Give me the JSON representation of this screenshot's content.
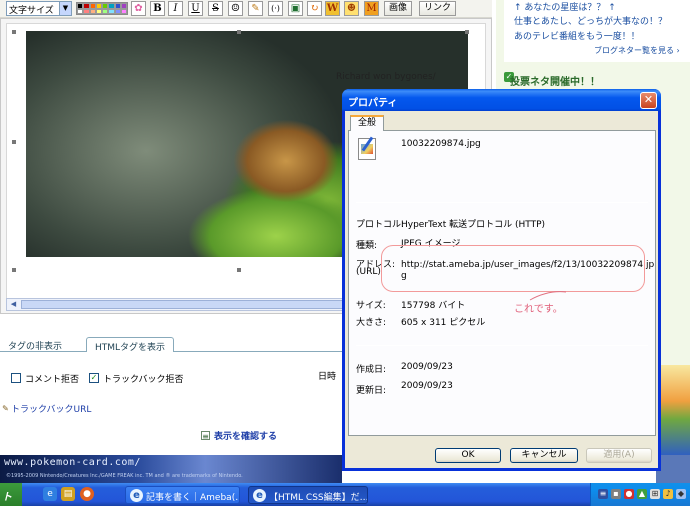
{
  "toolbar": {
    "font_size_label": "文字サイズ",
    "bold": "B",
    "italic": "I",
    "underline": "U",
    "strike": "S",
    "image_btn": "画像",
    "link_btn": "リンク",
    "palette_colors": [
      "#000000",
      "#c00000",
      "#ff6600",
      "#ffcc00",
      "#66cc00",
      "#00a0c0",
      "#3050d0",
      "#a040c0",
      "#ffffff",
      "#ff8080",
      "#ffb080",
      "#ffff80",
      "#a0ff80",
      "#80e0ff",
      "#8090ff",
      "#ff80ff"
    ]
  },
  "editor": {
    "photo_caption": "Richard won bygones/",
    "tabs": [
      "タグの非表示",
      "HTMLタグを表示"
    ],
    "comment_option": "コメント拒否",
    "trackback_option": "トラックバック拒否",
    "trackback_url": "トラックバックURL",
    "confirm_link": "表示を確認する",
    "date_label": "日時"
  },
  "sidebar": {
    "items": [
      "↑ あなたの星座は？？ ↑",
      "仕事とあたし、どっちが大事なの！？",
      "あのテレビ番組をもう一度！！"
    ],
    "more_link": "ブログネター覧を見る",
    "heading": "投票ネタ開催中！！"
  },
  "banner": {
    "text": "www.pokemon-card.com/",
    "small": "©1995-2009 Nintendo/Creatures Inc./GAME FREAK inc. TM and ® are trademarks of Nintendo."
  },
  "taskbar": {
    "start": "ト",
    "tasks": [
      "記事を書く｜Ameba(…",
      "【HTML CSS編集】だ…"
    ]
  },
  "dialog": {
    "title": "プロパティ",
    "tab": "全般",
    "filename": "10032209874.jpg",
    "protocol_label": "プロトコル:",
    "protocol_value": "HyperText 転送プロトコル (HTTP)",
    "type_label": "種類:",
    "type_value": "JPEG イメージ",
    "address_label_1": "アドレス:",
    "address_label_2": "(URL)",
    "address_value_1": "http://stat.ameba.jp/user_images/f2/13/10032209874.jp",
    "address_value_2": "g",
    "size_label": "サイズ:",
    "size_value": "157798 バイト",
    "dimensions_label": "大きさ:",
    "dimensions_value": "605 x 311 ピクセル",
    "created_label": "作成日:",
    "created_value": "2009/09/23",
    "updated_label": "更新日:",
    "updated_value": "2009/09/23",
    "annotation": "これです。",
    "ok": "OK",
    "cancel": "キャンセル",
    "apply": "適用(A)"
  }
}
